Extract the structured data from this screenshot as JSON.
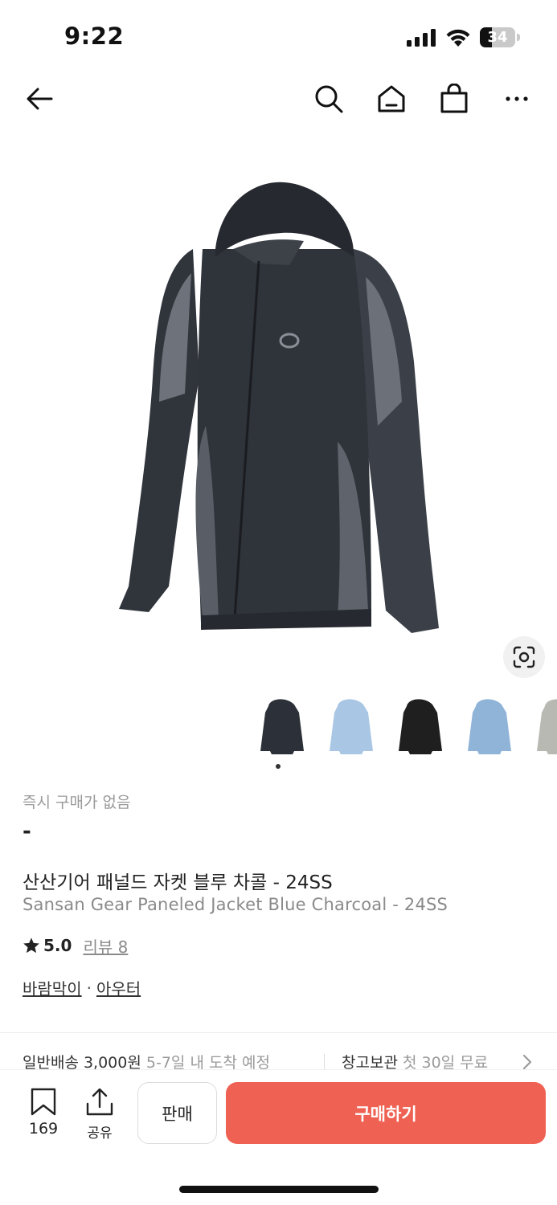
{
  "status_bar": {
    "time": "9:22",
    "battery_level": "34",
    "icons": [
      "signal-icon",
      "wifi-icon",
      "battery-icon"
    ]
  },
  "nav": {
    "icons": [
      "back-arrow-icon",
      "search-icon",
      "home-icon",
      "shopping-bag-icon",
      "more-icon"
    ]
  },
  "product": {
    "instant_purchase": "즉시 구매가 없음",
    "price": "-",
    "name_ko": "산산기어 패널드 자켓 블루 차콜 - 24SS",
    "name_en": "Sansan Gear Paneled Jacket Blue Charcoal - 24SS",
    "rating": "5.0",
    "review_label": "리뷰 8",
    "categories": [
      "바람막이",
      "아우터"
    ],
    "category_separator": "·",
    "thumbnail_colors": [
      "#2c3038",
      "#a9c7e4",
      "#1f1f1f",
      "#8fb4d8",
      "#b9b9b4"
    ]
  },
  "shipping": {
    "general_label": "일반배송 3,000원",
    "general_eta": "5-7일 내 도착 예정",
    "storage_label": "창고보관",
    "storage_note": "첫 30일 무료"
  },
  "bottom_bar": {
    "bookmark_count": "169",
    "share_label": "공유",
    "sell_label": "판매",
    "buy_label": "구매하기"
  },
  "colors": {
    "accent": "#ef6253",
    "muted_text": "#9a9a9a"
  }
}
